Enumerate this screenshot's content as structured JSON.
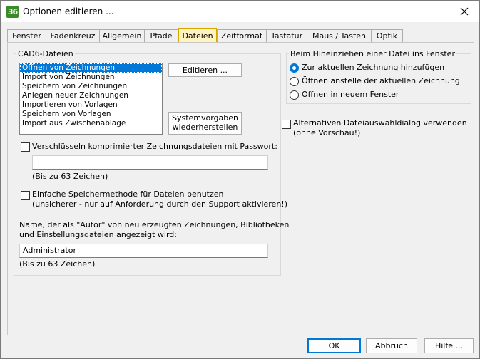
{
  "window": {
    "title": "Optionen editieren ...",
    "app_icon": "36"
  },
  "tabs": [
    {
      "label": "Fenster"
    },
    {
      "label": "Fadenkreuz"
    },
    {
      "label": "Allgemein"
    },
    {
      "label": "Pfade"
    },
    {
      "label": "Dateien",
      "active": true
    },
    {
      "label": "Zeitformat"
    },
    {
      "label": "Tastatur"
    },
    {
      "label": "Maus / Tasten"
    },
    {
      "label": "Optik"
    }
  ],
  "cad6": {
    "group_label": "CAD6-Dateien",
    "list": [
      "Öffnen von Zeichnungen",
      "Import von Zeichnungen",
      "Speichern von Zeichnungen",
      "Anlegen neuer Zeichnungen",
      "Importieren von Vorlagen",
      "Speichern von Vorlagen",
      "Import aus Zwischenablage"
    ],
    "selected_index": 0,
    "edit_button": "Editieren ...",
    "defaults_button_line1": "Systemvorgaben",
    "defaults_button_line2": "wiederherstellen",
    "encrypt_label": "Verschlüsseln komprimierter Zeichnungsdateien mit Passwort:",
    "encrypt_checked": false,
    "password_value": "",
    "password_hint": "(Bis zu 63 Zeichen)",
    "simple_save_line1": "Einfache Speichermethode für Dateien benutzen",
    "simple_save_line2": "(unsicherer - nur auf Anforderung durch den Support aktivieren!)",
    "simple_save_checked": false,
    "author_label_line1": "Name, der als \"Autor\" von neu erzeugten Zeichnungen, Bibliotheken",
    "author_label_line2": "und Einstellungsdateien angezeigt wird:",
    "author_value": "Administrator",
    "author_hint": "(Bis zu 63 Zeichen)"
  },
  "drag": {
    "group_label": "Beim Hineinziehen einer Datei ins Fenster",
    "options": [
      {
        "label": "Zur aktuellen Zeichnung hinzufügen",
        "checked": true
      },
      {
        "label": "Öffnen anstelle der aktuellen Zeichnung",
        "checked": false
      },
      {
        "label": "Öffnen in neuem Fenster",
        "checked": false
      }
    ]
  },
  "alt_dialog": {
    "line1": "Alternativen Dateiauswahldialog verwenden",
    "line2": "(ohne Vorschau!)",
    "checked": false
  },
  "footer": {
    "ok": "OK",
    "cancel": "Abbruch",
    "help": "Hilfe ..."
  },
  "colors": {
    "accent": "#0078d7",
    "active_tab": "#fff3c0",
    "app_icon": "#3a8a2a"
  }
}
